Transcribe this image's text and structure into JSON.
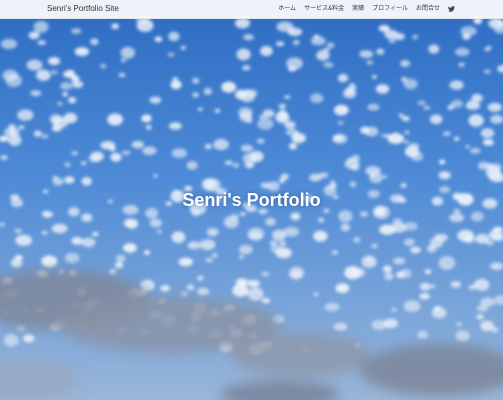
{
  "header": {
    "site_title": "Senri's Portfolio Site",
    "nav": [
      {
        "label": "ホーム"
      },
      {
        "label": "サービス&料金"
      },
      {
        "label": "実績"
      },
      {
        "label": "プロフィール"
      },
      {
        "label": "お問合せ"
      }
    ],
    "social_icon": "twitter-icon"
  },
  "hero": {
    "title": "Senri's Portfolio",
    "background": "blue-sky-with-clouds"
  },
  "colors": {
    "sky_top": "#2f6fc4",
    "sky_mid": "#5b93d8",
    "sky_bottom": "#8fb3de",
    "cloud": "#e8eef7",
    "dark_cloud": "#7d8598",
    "header_bg": "#ffffff"
  }
}
